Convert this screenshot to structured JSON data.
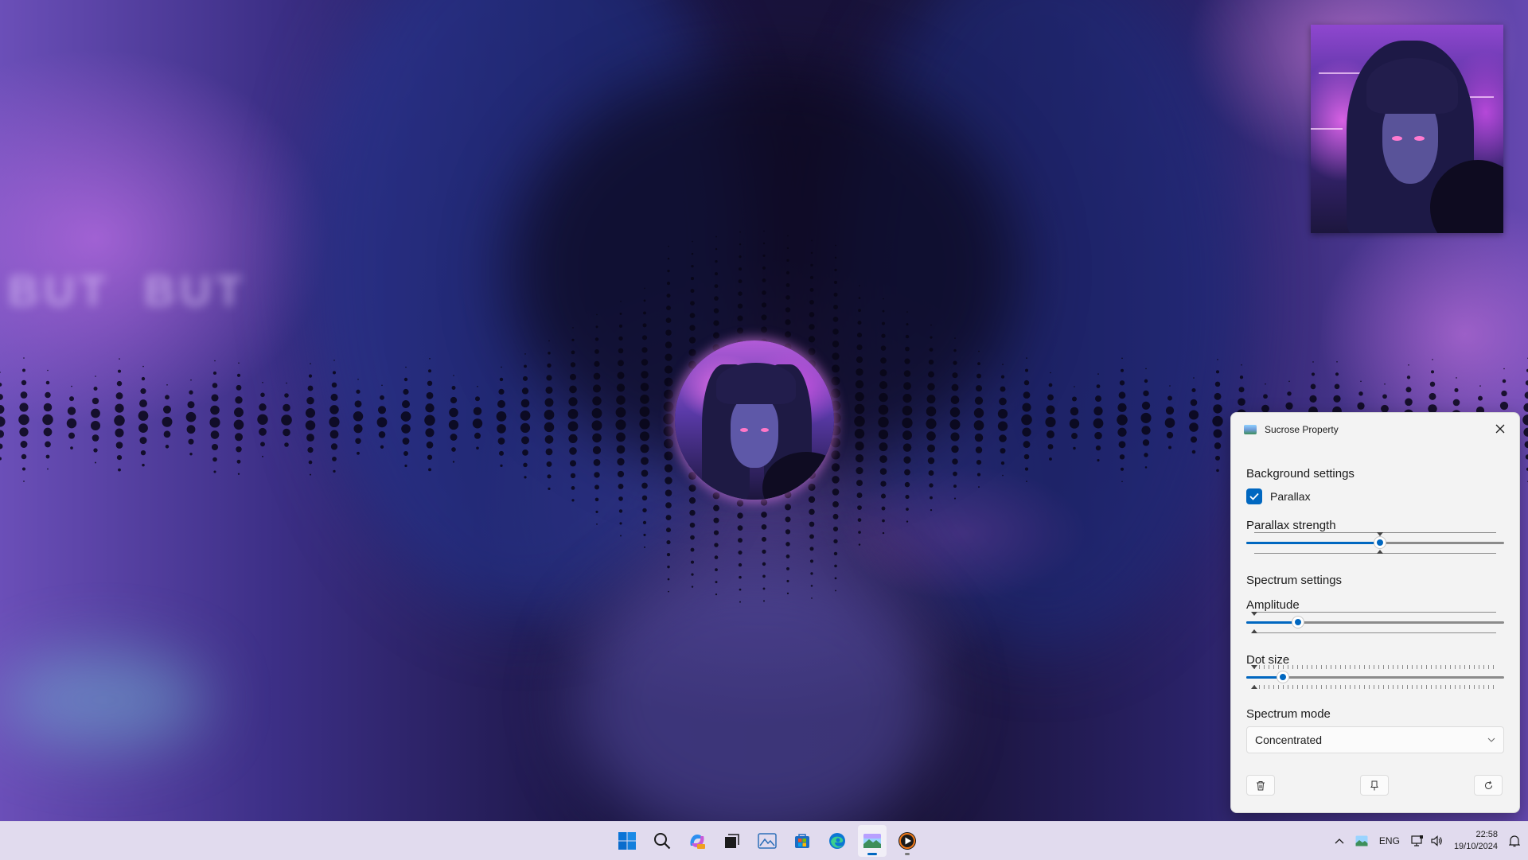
{
  "panel": {
    "title": "Sucrose Property",
    "background_section": "Background settings",
    "parallax": {
      "label": "Parallax",
      "checked": true
    },
    "parallax_strength": {
      "label": "Parallax strength",
      "value": 0.52
    },
    "spectrum_section": "Spectrum settings",
    "amplitude": {
      "label": "Amplitude",
      "value": 0.18
    },
    "dot_size": {
      "label": "Dot size",
      "value": 0.12
    },
    "spectrum_mode": {
      "label": "Spectrum mode",
      "selected": "Concentrated"
    },
    "buttons": [
      "trash-icon",
      "pin-icon",
      "refresh-icon"
    ],
    "accent": "#0067c0"
  },
  "taskbar": {
    "apps": [
      "windows-start-icon",
      "search-icon",
      "copilot-icon",
      "task-view-icon",
      "photos-icon",
      "microsoft-store-icon",
      "edge-icon",
      "sucrose-icon",
      "media-player-icon"
    ],
    "tray": {
      "language": "ENG",
      "time": "22:58",
      "date": "19/10/2024"
    }
  }
}
